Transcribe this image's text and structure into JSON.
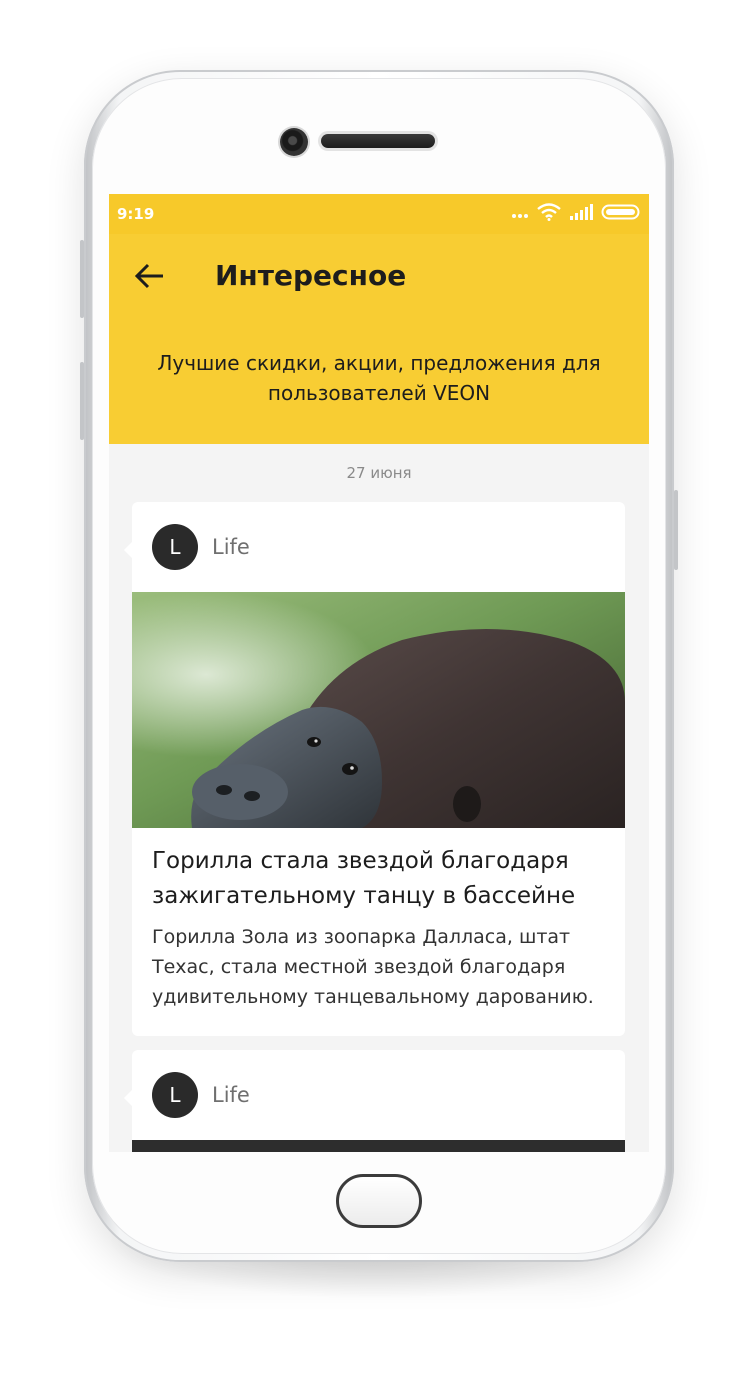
{
  "status_bar": {
    "time": "9:19",
    "icons": [
      "more-dots-icon",
      "wifi-icon",
      "signal-icon",
      "battery-icon"
    ]
  },
  "header": {
    "title": "Интересное",
    "subtitle": "Лучшие скидки, акции, предложения для пользователей VEON",
    "background_color": "#f8cd33"
  },
  "feed": {
    "date": "27 июня",
    "cards": [
      {
        "avatar_letter": "L",
        "source": "Life",
        "title": "Горилла стала звездой благодаря зажигательному танцу в бассейне",
        "text": "Горилла Зола из зоопарка Далласа, штат Техас, стала местной звездой благодаря удивительному танцевальному дарованию."
      },
      {
        "avatar_letter": "L",
        "source": "Life"
      }
    ]
  }
}
